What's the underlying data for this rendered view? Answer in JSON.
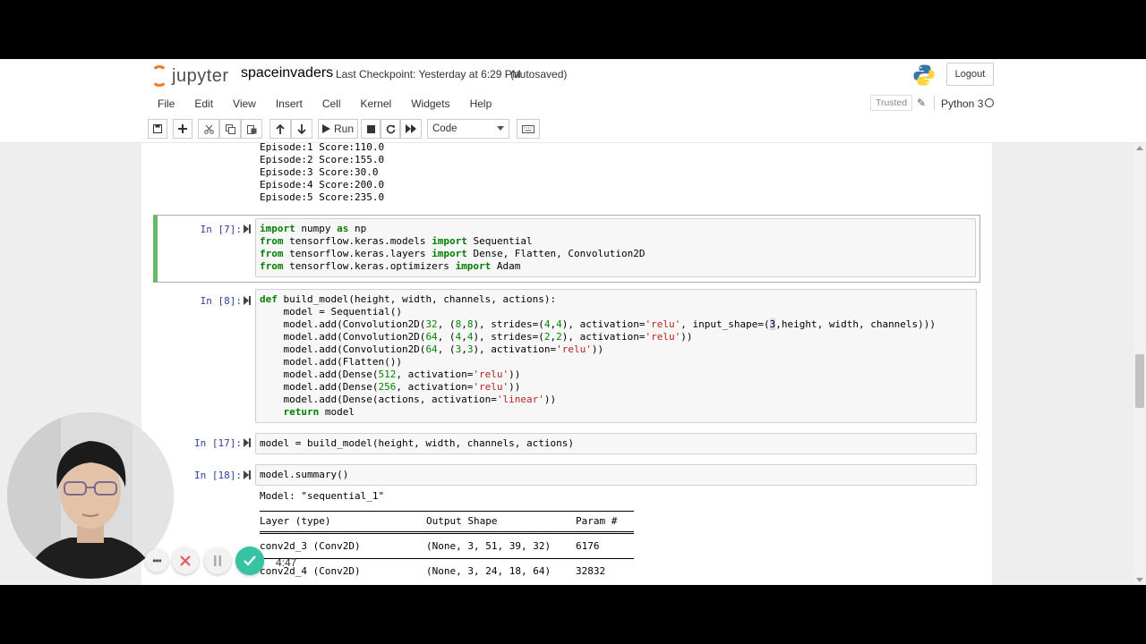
{
  "header": {
    "logo_text": "jupyter",
    "notebook_name": "spaceinvaders",
    "checkpoint": "Last Checkpoint: Yesterday at 6:29 PM",
    "autosave_status": "(autosaved)",
    "logout_label": "Logout"
  },
  "menu": {
    "items": [
      "File",
      "Edit",
      "View",
      "Insert",
      "Cell",
      "Kernel",
      "Widgets",
      "Help"
    ],
    "trusted_label": "Trusted",
    "kernel_name": "Python 3"
  },
  "toolbar": {
    "run_label": "Run",
    "cell_type": "Code"
  },
  "prev_output": {
    "lines": [
      "Episode:1 Score:110.0",
      "Episode:2 Score:155.0",
      "Episode:3 Score:30.0",
      "Episode:4 Score:200.0",
      "Episode:5 Score:235.0"
    ]
  },
  "cells": [
    {
      "prompt": "In [7]:",
      "lines": [
        [
          {
            "t": "import",
            "c": "kw"
          },
          {
            "t": " numpy "
          },
          {
            "t": "as",
            "c": "kw"
          },
          {
            "t": " np"
          }
        ],
        [
          {
            "t": "from",
            "c": "kw"
          },
          {
            "t": " tensorflow.keras.models "
          },
          {
            "t": "import",
            "c": "kw"
          },
          {
            "t": " Sequential"
          }
        ],
        [
          {
            "t": "from",
            "c": "kw"
          },
          {
            "t": " tensorflow.keras.layers "
          },
          {
            "t": "import",
            "c": "kw"
          },
          {
            "t": " Dense, Flatten, Convolution2D"
          }
        ],
        [
          {
            "t": "from",
            "c": "kw"
          },
          {
            "t": " tensorflow.keras.optimizers "
          },
          {
            "t": "import",
            "c": "kw"
          },
          {
            "t": " Adam"
          }
        ]
      ]
    },
    {
      "prompt": "In [8]:",
      "lines": [
        [
          {
            "t": "def",
            "c": "kw"
          },
          {
            "t": " build_model(height, width, channels, actions):"
          }
        ],
        [
          {
            "t": "    model = Sequential()"
          }
        ],
        [
          {
            "t": "    model.add(Convolution2D("
          },
          {
            "t": "32",
            "c": "num"
          },
          {
            "t": ", ("
          },
          {
            "t": "8",
            "c": "num"
          },
          {
            "t": ","
          },
          {
            "t": "8",
            "c": "num"
          },
          {
            "t": "), strides=("
          },
          {
            "t": "4",
            "c": "num"
          },
          {
            "t": ","
          },
          {
            "t": "4",
            "c": "num"
          },
          {
            "t": "), activation="
          },
          {
            "t": "'relu'",
            "c": "str"
          },
          {
            "t": ", input_shape=("
          },
          {
            "t": "3",
            "c": "hl"
          },
          {
            "t": ",height, width, channels)))"
          }
        ],
        [
          {
            "t": "    model.add(Convolution2D("
          },
          {
            "t": "64",
            "c": "num"
          },
          {
            "t": ", ("
          },
          {
            "t": "4",
            "c": "num"
          },
          {
            "t": ","
          },
          {
            "t": "4",
            "c": "num"
          },
          {
            "t": "), strides=("
          },
          {
            "t": "2",
            "c": "num"
          },
          {
            "t": ","
          },
          {
            "t": "2",
            "c": "num"
          },
          {
            "t": "), activation="
          },
          {
            "t": "'relu'",
            "c": "str"
          },
          {
            "t": "))"
          }
        ],
        [
          {
            "t": "    model.add(Convolution2D("
          },
          {
            "t": "64",
            "c": "num"
          },
          {
            "t": ", ("
          },
          {
            "t": "3",
            "c": "num"
          },
          {
            "t": ","
          },
          {
            "t": "3",
            "c": "num"
          },
          {
            "t": "), activation="
          },
          {
            "t": "'relu'",
            "c": "str"
          },
          {
            "t": "))"
          }
        ],
        [
          {
            "t": "    model.add(Flatten())"
          }
        ],
        [
          {
            "t": "    model.add(Dense("
          },
          {
            "t": "512",
            "c": "num"
          },
          {
            "t": ", activation="
          },
          {
            "t": "'relu'",
            "c": "str"
          },
          {
            "t": "))"
          }
        ],
        [
          {
            "t": "    model.add(Dense("
          },
          {
            "t": "256",
            "c": "num"
          },
          {
            "t": ", activation="
          },
          {
            "t": "'relu'",
            "c": "str"
          },
          {
            "t": "))"
          }
        ],
        [
          {
            "t": "    model.add(Dense(actions, activation="
          },
          {
            "t": "'linear'",
            "c": "str"
          },
          {
            "t": "))"
          }
        ],
        [
          {
            "t": "    "
          },
          {
            "t": "return",
            "c": "kw"
          },
          {
            "t": " model"
          }
        ]
      ]
    },
    {
      "prompt": "In [17]:",
      "lines": [
        [
          {
            "t": "model = build_model(height, width, channels, actions)"
          }
        ]
      ]
    },
    {
      "prompt": "In [18]:",
      "lines": [
        [
          {
            "t": "model.summary()"
          }
        ]
      ]
    }
  ],
  "summary": {
    "model_line": "Model: \"sequential_1\"",
    "headers": [
      "Layer (type)",
      "Output Shape",
      "Param #"
    ],
    "rows": [
      [
        "conv2d_3 (Conv2D)",
        "(None, 3, 51, 39, 32)",
        "6176"
      ],
      [
        "conv2d_4 (Conv2D)",
        "(None, 3, 24, 18, 64)",
        "32832"
      ]
    ]
  },
  "recorder": {
    "time": "4:47"
  },
  "colors": {
    "selected_cell": "#66bb6a",
    "prompt": "#303f9f",
    "keyword": "#008000",
    "string": "#ba2121",
    "jupyter_orange": "#f37726"
  }
}
